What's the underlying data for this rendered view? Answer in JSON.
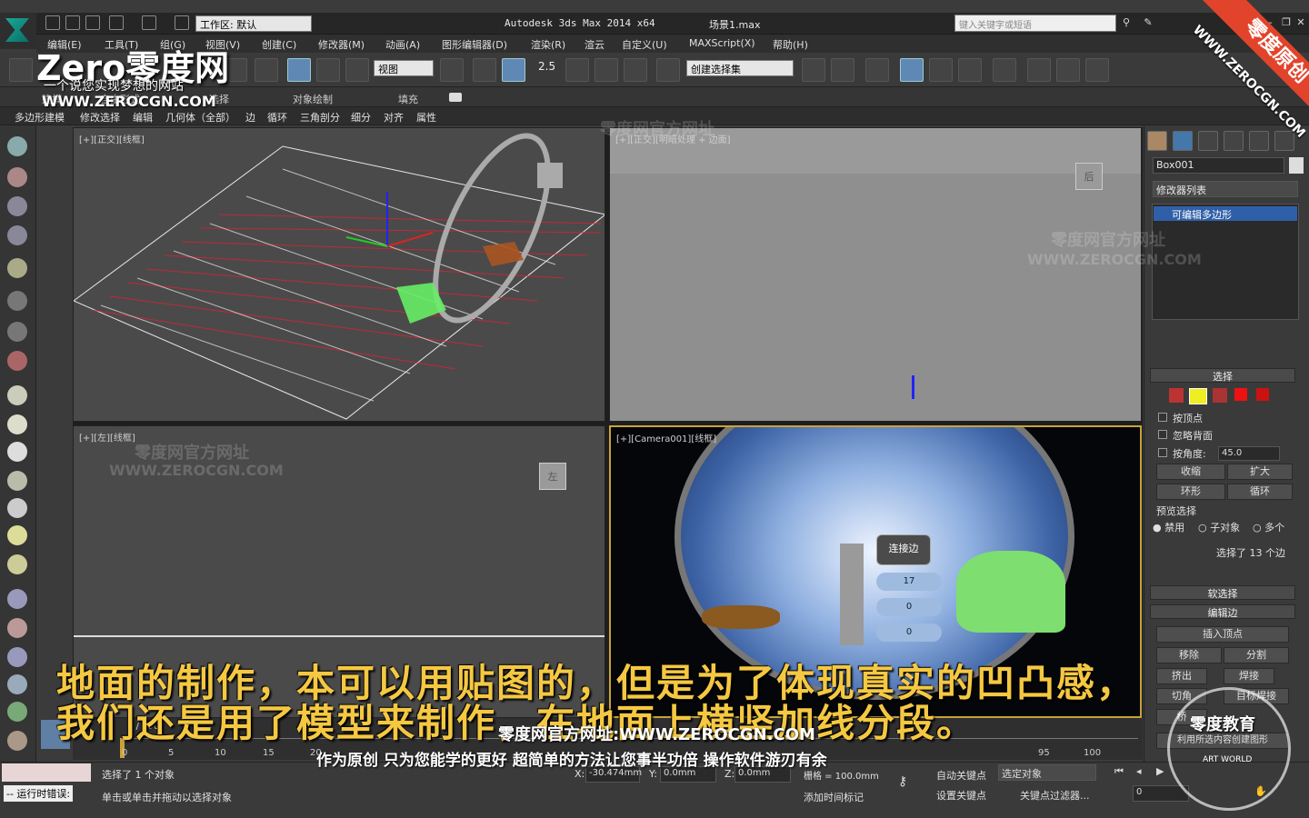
{
  "app": {
    "title": "Autodesk 3ds Max  2014 x64",
    "scene": "场景1.max",
    "workspace_label": "工作区: 默认",
    "search_placeholder": "键入关键字或短语"
  },
  "menus": [
    "编辑(E)",
    "工具(T)",
    "组(G)",
    "视图(V)",
    "创建(C)",
    "修改器(M)",
    "动画(A)",
    "图形编辑器(D)",
    "渲染(R)",
    "渲云",
    "自定义(U)",
    "MAXScript(X)",
    "帮助(H)"
  ],
  "toolbar": {
    "view_dropdown": "视图",
    "snap_value": "2.5",
    "named_selection": "创建选择集"
  },
  "ribbon": {
    "tabs": [
      "建模",
      "自由形式",
      "选择",
      "对象绘制",
      "填充"
    ],
    "subtabs": [
      "多边形建模",
      "修改选择",
      "编辑",
      "几何体（全部）",
      "边",
      "循环",
      "三角剖分",
      "细分",
      "对齐",
      "属性"
    ]
  },
  "viewports": {
    "top_left": {
      "label": "[+][正交][线框]"
    },
    "top_right": {
      "label": "[+][正交][明暗处理 + 边面]",
      "cube": "后"
    },
    "bottom_left": {
      "label": "[+][左][线框]",
      "cube": "左"
    },
    "bottom_right": {
      "label": "[+][Camera001][线框]",
      "caddy_title": "连接边",
      "caddy_values": [
        "17",
        "0",
        "0"
      ]
    }
  },
  "command_panel": {
    "object_name": "Box001",
    "modifier_list": "修改器列表",
    "stack_item": "可编辑多边形",
    "selection": {
      "header": "选择",
      "by_vertex": "按顶点",
      "ignore_back": "忽略背面",
      "by_angle": "按角度:",
      "angle_value": "45.0",
      "shrink": "收缩",
      "grow": "扩大",
      "ring": "环形",
      "loop": "循环",
      "preview_label": "预览选择",
      "preview_opts": [
        "禁用",
        "子对象",
        "多个"
      ],
      "status": "选择了 13 个边"
    },
    "soft_selection": "软选择",
    "edit_edges": "编辑边",
    "insert_vertex": "插入顶点",
    "remove": "移除",
    "split": "分割",
    "extrude": "挤出",
    "weld": "焊接",
    "chamfer": "切角",
    "target_weld": "目标焊接",
    "bridge": "桥",
    "create_shape": "利用所选内容创建图形"
  },
  "timeline": {
    "frame": "0 / 100",
    "ticks": [
      "0",
      "5",
      "10",
      "15",
      "20",
      "95",
      "100"
    ]
  },
  "status": {
    "selected": "选择了 1 个对象",
    "prompt": "单击或单击并拖动以选择对象",
    "error_label": "-- 运行时错误:",
    "x": "-30.474mm",
    "y": "0.0mm",
    "z": "0.0mm",
    "grid": "栅格 = 100.0mm",
    "auto_key": "自动关键点",
    "set_key": "设置关键点",
    "selected_obj": "选定对象",
    "key_filter": "关键点过滤器...",
    "add_time_tag": "添加时间标记",
    "frame_field": "0"
  },
  "subtitles": {
    "line1": "地面的制作，本可以用贴图的，但是为了体现真实的凹凸感，",
    "line2": "我们还是用了模型来制作，在地面上横竖加线分段。",
    "site": "零度网官方网址:WWW.ZEROCGN.COM",
    "slogan": "作为原创 只为您能学的更好 超简单的方法让您事半功倍 操作软件游刃有余"
  },
  "watermarks": {
    "brand": "Zero零度网",
    "tagline": "一个说您实现梦想的网站",
    "url": "WWW.ZEROCGN.COM",
    "corner": "零度原创",
    "corner_url": "WWW.ZEROCGN.COM",
    "official": "零度网官方网址",
    "edu": "零度教育",
    "art": "ART WORLD"
  }
}
